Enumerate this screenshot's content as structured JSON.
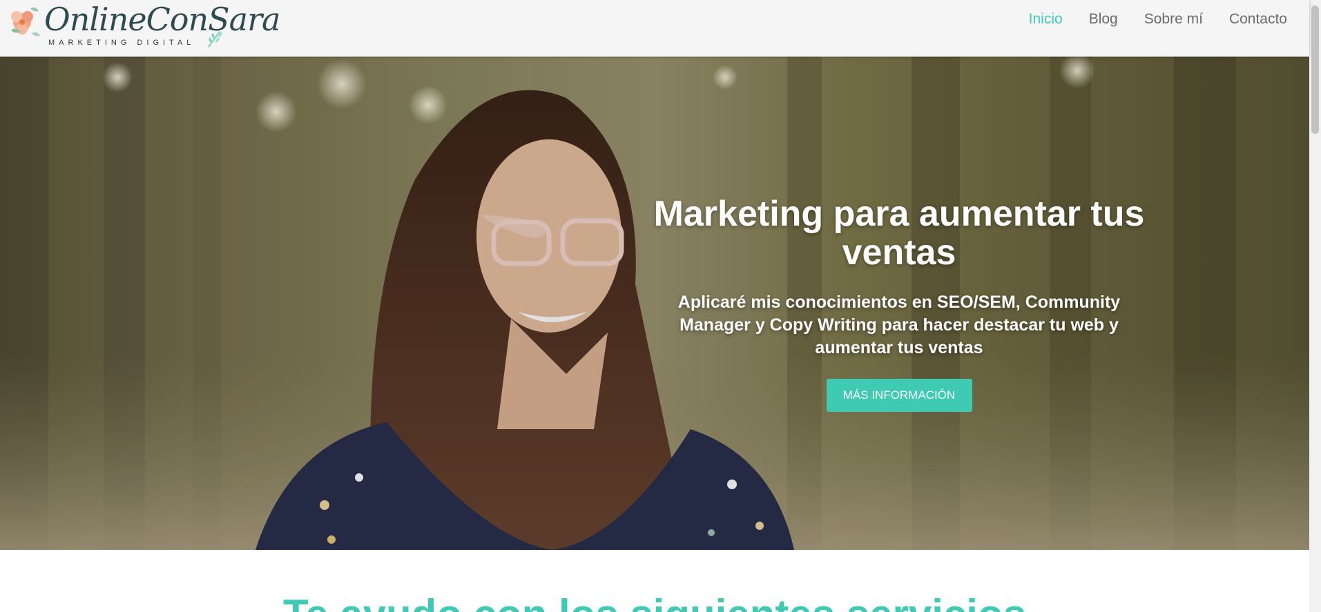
{
  "brand": {
    "name": "OnlineConSara",
    "tagline": "MARKETING DIGITAL"
  },
  "nav": {
    "items": [
      {
        "label": "Inicio",
        "active": true
      },
      {
        "label": "Blog",
        "active": false
      },
      {
        "label": "Sobre mí",
        "active": false
      },
      {
        "label": "Contacto",
        "active": false
      }
    ]
  },
  "hero": {
    "title": "Marketing para aumentar tus ventas",
    "subtitle": "Aplicaré mis conocimientos en SEO/SEM, Community Manager y Copy Writing para hacer destacar tu web y aumentar tus ventas",
    "cta_label": "MÁS INFORMACIÓN"
  },
  "section": {
    "heading": "Te ayudo con los siguientes servicios"
  },
  "colors": {
    "accent": "#3fcab4",
    "nav_text": "#6b6b6b",
    "header_bg": "#f5f5f5"
  }
}
